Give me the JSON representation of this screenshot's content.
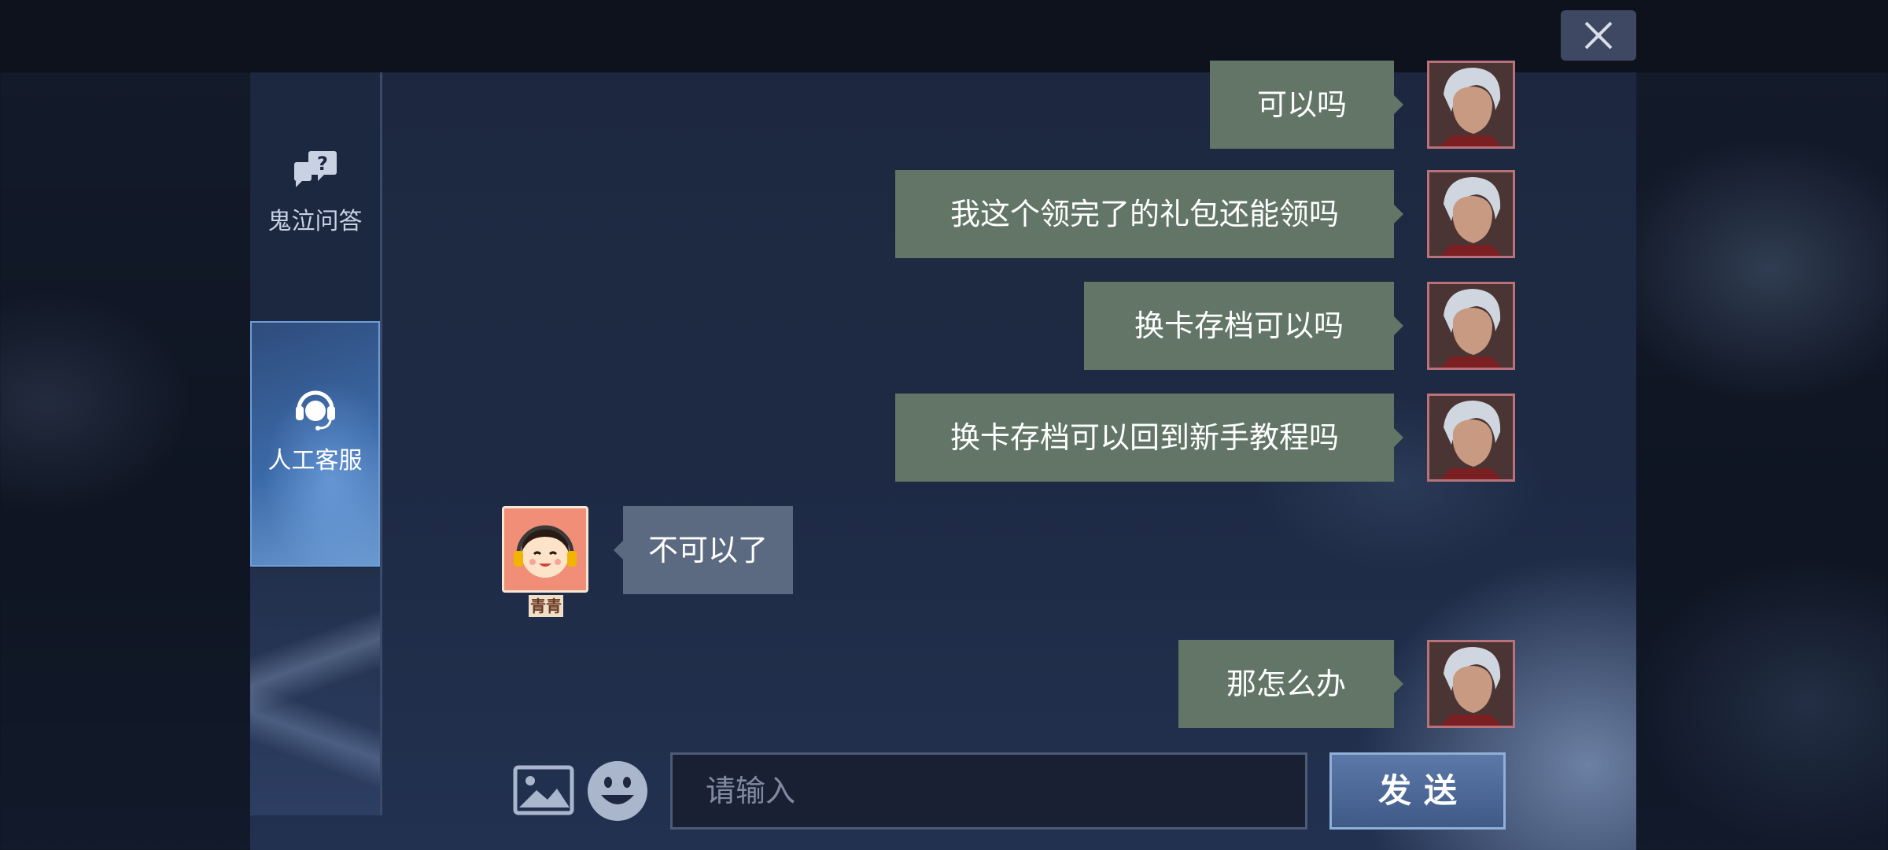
{
  "sidebar": {
    "items": [
      {
        "label": "鬼泣问答",
        "icon": "question-bubbles-icon"
      },
      {
        "label": "人工客服",
        "icon": "headset-support-icon"
      }
    ]
  },
  "chat": {
    "messages": [
      {
        "from": "user",
        "text": "可以吗"
      },
      {
        "from": "user",
        "text": "我这个领完了的礼包还能领吗"
      },
      {
        "from": "user",
        "text": "换卡存档可以吗"
      },
      {
        "from": "user",
        "text": "换卡存档可以回到新手教程吗"
      },
      {
        "from": "agent",
        "text": "不可以了",
        "name": "青青"
      },
      {
        "from": "user",
        "text": "那怎么办"
      }
    ]
  },
  "composer": {
    "placeholder": "请输入",
    "send_label": "发送",
    "image_icon": "image-icon",
    "emoji_icon": "emoji-icon"
  },
  "close_icon": "close-icon",
  "colors": {
    "user_bubble": "#627566",
    "agent_bubble": "#5b6a80",
    "send_button": "#4a6898",
    "active_tab": "#3b6aa8"
  }
}
